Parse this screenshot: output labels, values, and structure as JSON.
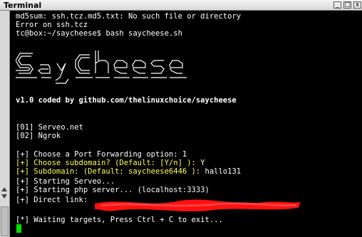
{
  "window": {
    "title": "Terminal"
  },
  "titlebar_buttons": [
    {
      "name": "minimize-button",
      "glyph": "_"
    },
    {
      "name": "maximize-button",
      "glyph": "□"
    },
    {
      "name": "close-button",
      "glyph": "x"
    }
  ],
  "terminal": {
    "line1": "md5sum: ssh.tcz.md5.txt: No such file or directory",
    "line2": "Error on ssh.tcz",
    "prompt": "tc@box:~/saycheese$ bash saycheese.sh",
    "banner_caption": "v1.0 coded by github.com/thelinuxchoice/saycheese",
    "menu": [
      {
        "num": "[01]",
        "label": "Serveo.net"
      },
      {
        "num": "[02]",
        "label": "Ngrok"
      }
    ],
    "choose_port": {
      "mark": "[+]",
      "text": " Choose a Port Forwarding option: ",
      "value": "1"
    },
    "choose_subdomain": {
      "mark": "[+]",
      "text": " Choose subdomain? (Default: [Y/n] ): ",
      "value": "Y"
    },
    "subdomain": {
      "mark": "[+]",
      "text": " Subdomain: (Default: saycheese6446 ): ",
      "value": "hallo131"
    },
    "starting_serveo": {
      "mark": "[+]",
      "text": " Starting Serveo..."
    },
    "starting_php": {
      "mark": "[+]",
      "text": " Starting php server... (localhost:3333)"
    },
    "direct_link": {
      "mark": "[+]",
      "text": " Direct link:"
    },
    "waiting": {
      "mark": "[*]",
      "text": " Waiting targets, Press Ctrl + C to exit..."
    }
  }
}
